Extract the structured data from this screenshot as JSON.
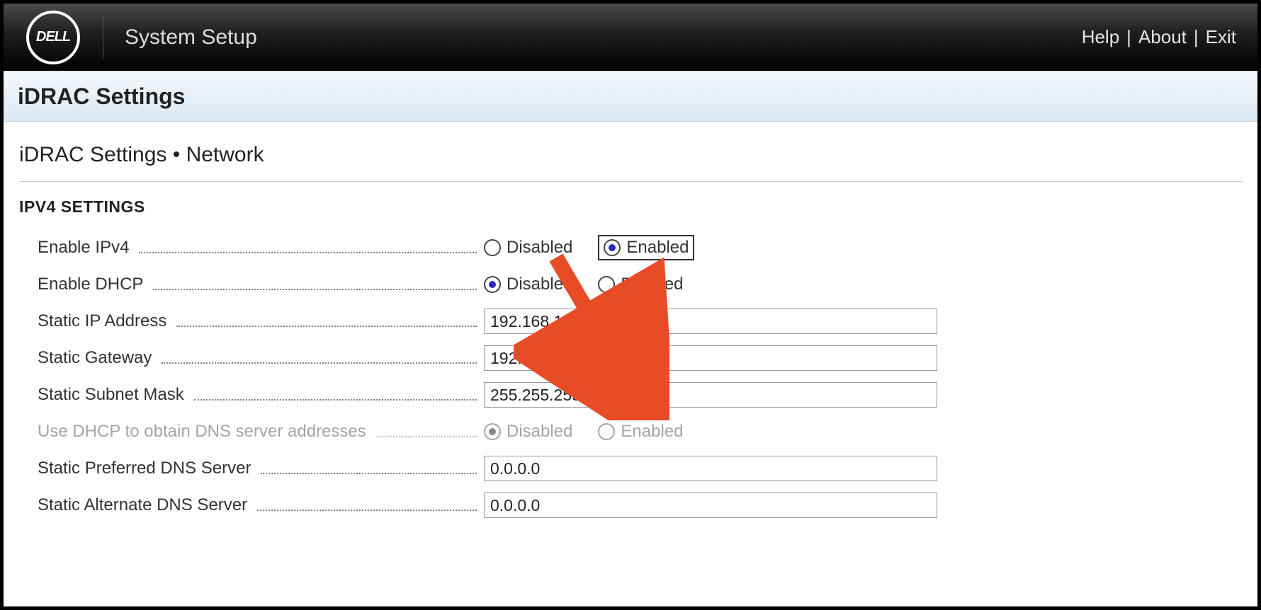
{
  "topbar": {
    "brand": "DELL",
    "title": "System Setup",
    "links": {
      "help": "Help",
      "about": "About",
      "exit": "Exit"
    }
  },
  "page_header": "iDRAC Settings",
  "breadcrumb": "iDRAC Settings • Network",
  "section": "IPV4 SETTINGS",
  "radio_labels": {
    "disabled": "Disabled",
    "enabled": "Enabled"
  },
  "fields": {
    "enable_ipv4": {
      "label": "Enable IPv4",
      "value": "Enabled"
    },
    "enable_dhcp": {
      "label": "Enable DHCP",
      "value": "Disabled"
    },
    "static_ip": {
      "label": "Static IP Address",
      "value": "192.168.1.101"
    },
    "static_gw": {
      "label": "Static Gateway",
      "value": "192.168.1.254"
    },
    "static_mask": {
      "label": "Static Subnet Mask",
      "value": "255.255.255.0"
    },
    "dhcp_dns": {
      "label": "Use DHCP to obtain DNS server addresses",
      "value": "Disabled"
    },
    "dns_pref": {
      "label": "Static Preferred DNS Server",
      "value": "0.0.0.0"
    },
    "dns_alt": {
      "label": "Static Alternate DNS Server",
      "value": "0.0.0.0"
    }
  }
}
